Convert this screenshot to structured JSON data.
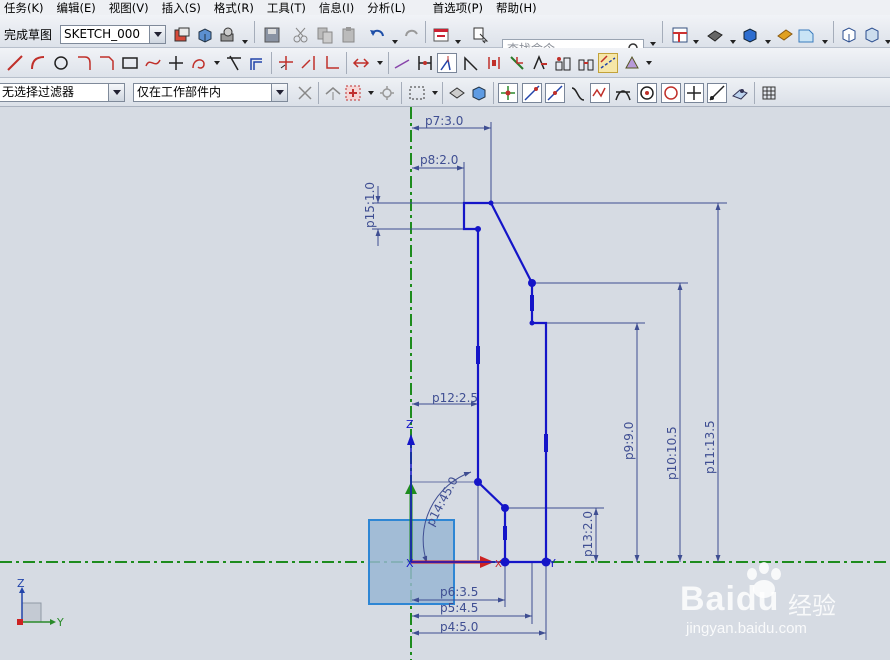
{
  "menu": {
    "items": [
      "任务(K)",
      "编辑(E)",
      "视图(V)",
      "插入(S)",
      "格式(R)",
      "工具(T)",
      "信息(I)",
      "分析(L)",
      "首选项(P)",
      "帮助(H)"
    ]
  },
  "toolbar": {
    "finish_sketch_label": "完成草图",
    "sketch_name": "SKETCH_000",
    "search_placeholder": "查找命令"
  },
  "selection_bar": {
    "type_filter": "无选择过滤器",
    "scope_filter": "仅在工作部件内"
  },
  "icons": {
    "curve_tools": [
      "line-icon",
      "arc-icon",
      "circle-icon",
      "fillet-icon",
      "chamfer-icon",
      "rectangle-icon",
      "polygon-icon",
      "point-icon",
      "offset-curve-icon",
      "trim-icon",
      "extend-icon",
      "mirror-icon"
    ],
    "constraint_tools": [
      "dimension-icon",
      "constraint-icon",
      "auto-constrain-icon",
      "show-constraints-icon",
      "horizontal-constraint-icon",
      "vertical-constraint-icon"
    ],
    "snap_tools": [
      "endpoint-snap-icon",
      "midpoint-snap-icon",
      "control-point-icon",
      "intersection-snap-icon",
      "center-snap-icon",
      "quadrant-snap-icon",
      "point-on-curve-icon",
      "point-on-surface-icon"
    ]
  },
  "canvas": {
    "background": "#d6dbe3",
    "profile_color": "#1515c8",
    "axis_color": "#1e8c1e",
    "dimension_color": "#3f4e92",
    "z_axis_label": "Z",
    "y_axis_label": "Y",
    "origin_mark": "X",
    "dimensions": {
      "p7": "p7:3.0",
      "p8": "p8:2.0",
      "p15": "p15:1.0",
      "p12": "p12:2.5",
      "p14": "p14:45.0",
      "p9": "p9:9.0",
      "p10": "p10:10.5",
      "p11": "p11:13.5",
      "p13": "p13:2.0",
      "p6": "p6:3.5",
      "p5": "p5:4.5",
      "p4": "p4:5.0"
    }
  },
  "triad": {
    "z_label": "Z",
    "y_label": "Y"
  },
  "watermark": {
    "logo": "Baidu",
    "tagline": "经验",
    "url": "jingyan.baidu.com"
  }
}
